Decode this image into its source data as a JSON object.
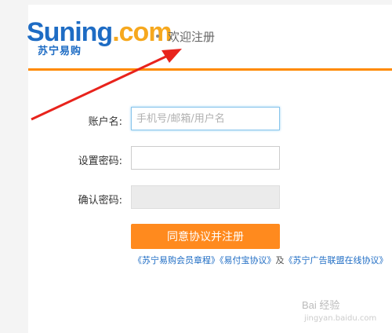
{
  "header": {
    "logo_text_main": "Suning",
    "logo_text_accent": ".com",
    "logo_subtitle": "苏宁易购",
    "page_title": "欢迎注册"
  },
  "form": {
    "account_label": "账户名:",
    "account_placeholder": "手机号/邮箱/用户名",
    "password_label": "设置密码:",
    "confirm_label": "确认密码:",
    "submit_label": "同意协议并注册"
  },
  "agreements": {
    "link1": "《苏宁易购会员章程》",
    "link2": "《易付宝协议》",
    "connector": "及",
    "link3": "《苏宁广告联盟在线协议》"
  },
  "colors": {
    "brand_blue": "#1e6cc4",
    "brand_orange": "#ff8a1e",
    "arrow_red": "#e8231c"
  },
  "watermark": {
    "text": "Bai 经验",
    "sub": "jingyan.baidu.com"
  }
}
